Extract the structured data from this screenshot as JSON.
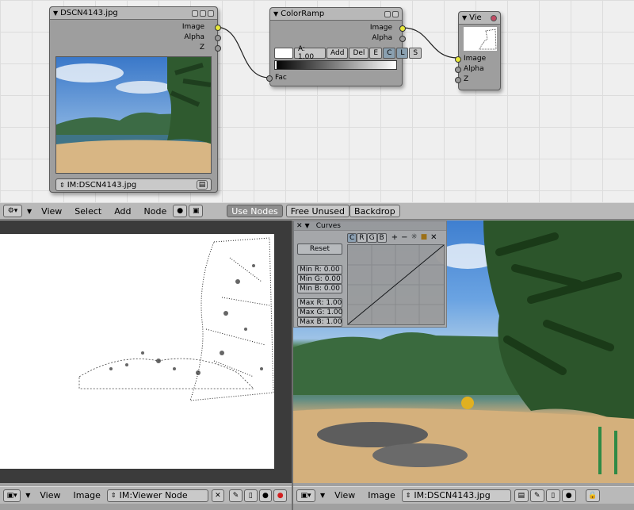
{
  "node_editor": {
    "image_node": {
      "title": "DSCN4143.jpg",
      "outputs": [
        "Image",
        "Alpha",
        "Z"
      ],
      "image_datablock": "IM:DSCN4143.jpg"
    },
    "colorramp_node": {
      "title": "ColorRamp",
      "outputs": [
        "Image",
        "Alpha"
      ],
      "alpha_label": "A: 1.00",
      "add_label": "Add",
      "del_label": "Del",
      "e_label": "E",
      "c_label": "C",
      "l_label": "L",
      "s_label": "S",
      "input": "Fac"
    },
    "viewer_node": {
      "title": "Vie",
      "inputs": [
        "Image",
        "Alpha",
        "Z"
      ]
    }
  },
  "node_header": {
    "menus": [
      "View",
      "Select",
      "Add",
      "Node"
    ],
    "use_nodes": "Use Nodes",
    "free_unused": "Free Unused",
    "backdrop": "Backdrop"
  },
  "curves": {
    "title": "Curves",
    "channels": [
      "C",
      "R",
      "G",
      "B"
    ],
    "reset": "Reset",
    "min_r": "Min R: 0.00",
    "min_g": "Min G: 0.00",
    "min_b": "Min B: 0.00",
    "max_r": "Max R: 1.00",
    "max_g": "Max G: 1.00",
    "max_b": "Max B: 1.00"
  },
  "left_status": {
    "menus": [
      "View",
      "Image"
    ],
    "datablock": "IM:Viewer Node"
  },
  "right_status": {
    "menus": [
      "View",
      "Image"
    ],
    "datablock": "IM:DSCN4143.jpg"
  },
  "colors": {
    "socket_yellow": "#e8e83a",
    "record_red": "#d22020",
    "background_grid": "#efefef"
  }
}
